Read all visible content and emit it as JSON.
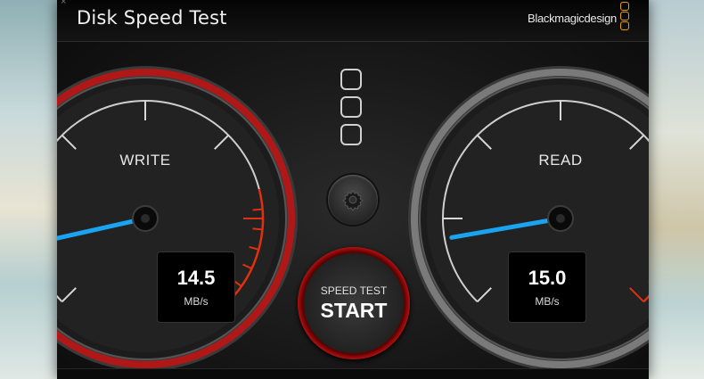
{
  "window": {
    "title": "Disk Speed Test",
    "brand": "Blackmagicdesign",
    "close_glyph": "×"
  },
  "write_gauge": {
    "label": "WRITE",
    "value": "14.5",
    "unit": "MB/s",
    "needle_level": 0.12,
    "ring_color": "#b01818"
  },
  "read_gauge": {
    "label": "READ",
    "value": "15.0",
    "unit": "MB/s",
    "needle_level": 0.13,
    "ring_color": "#7a7a7a"
  },
  "controls": {
    "speed_test_label": "SPEED TEST",
    "start_label": "START",
    "settings_icon": "gear-icon",
    "accent_color": "#e8a000",
    "needle_color": "#1aa3f0",
    "redline_color": "#e03010"
  }
}
